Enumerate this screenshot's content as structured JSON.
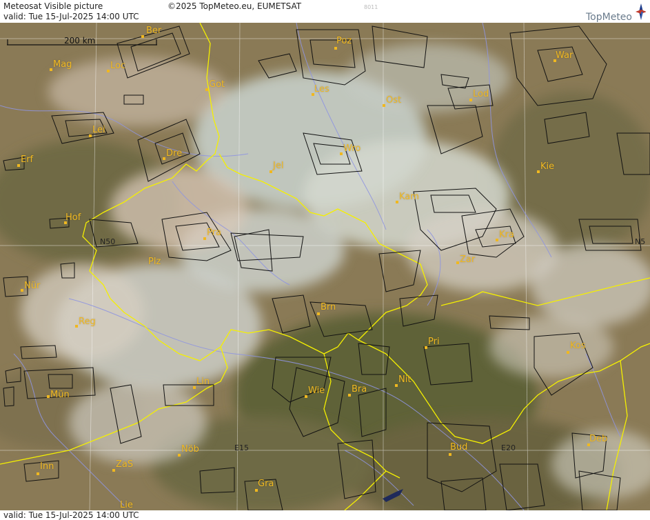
{
  "header": {
    "title": "Meteosat Visible picture",
    "valid": "valid:  Tue  15-Jul-2025  14:00 UTC",
    "copyright": "©2025 TopMeteo.eu, EUMETSAT",
    "code": "8011",
    "logo_text": "TopMeteo"
  },
  "footer": {
    "valid": "valid:  Tue  15-Jul-2025  14:00 UTC"
  },
  "map": {
    "scale_label": "200 km",
    "grid_labels": {
      "n50_left": "N50",
      "n50_right": "N5",
      "e15": "E15",
      "e20": "E20"
    },
    "cities": {
      "ber": "Ber",
      "poz": "Poz",
      "war": "War",
      "mag": "Mag",
      "loc": "Loc",
      "got": "Got",
      "les": "Les",
      "ost": "Ost",
      "lod": "Lod",
      "lei": "Lei",
      "dre": "Dre",
      "wro": "Wro",
      "erf": "Erf",
      "jel": "Jel",
      "kie": "Kie",
      "kam": "Kam",
      "hof": "Hof",
      "pra": "Pra",
      "kra": "Kra",
      "plz": "Plz",
      "zar": "Zar",
      "nur": "Nür",
      "brn": "Brn",
      "reg": "Reg",
      "pri": "Pri",
      "kos": "Kos",
      "lin": "Lin",
      "wie": "Wie",
      "bra": "Bra",
      "nit": "Nit",
      "mun": "Mün",
      "deb": "Deb",
      "nob": "Nöb",
      "bud": "Bud",
      "inn": "Inn",
      "zas": "ZaS",
      "gra": "Gra",
      "lie": "Lie"
    }
  },
  "colors": {
    "city": "#f0b820",
    "border": "#f5f000",
    "river": "#8f95e0",
    "grid": "#ffffff"
  }
}
